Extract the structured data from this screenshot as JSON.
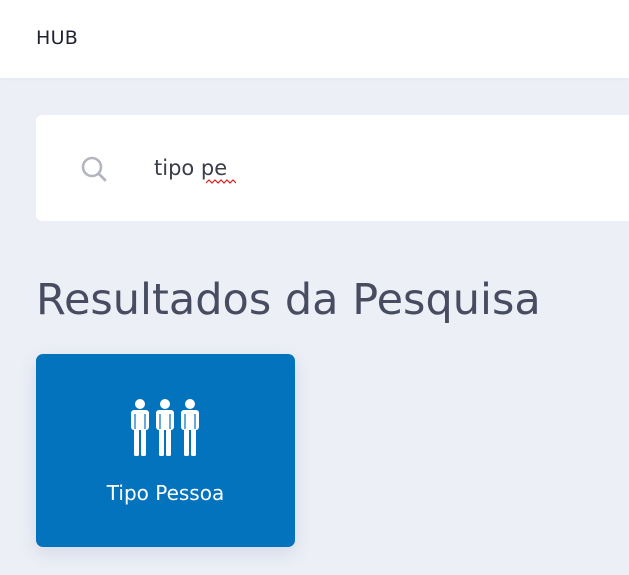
{
  "app": {
    "title": "HUB"
  },
  "search": {
    "value": "tipo pe",
    "icon": "search-icon"
  },
  "results": {
    "heading": "Resultados da Pesquisa",
    "items": [
      {
        "label": "Tipo Pessoa",
        "icon": "people-group-icon",
        "color": "#0473be"
      }
    ]
  },
  "colors": {
    "page_background": "#eceff6",
    "header_background": "#ffffff",
    "accent": "#0473be",
    "heading_text": "#484c60"
  }
}
